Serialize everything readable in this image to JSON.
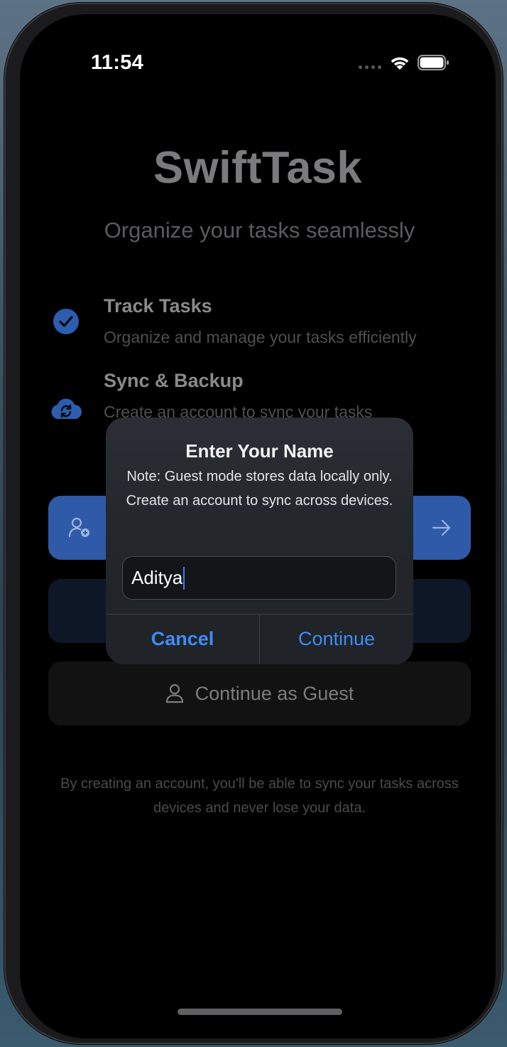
{
  "status_bar": {
    "time": "11:54"
  },
  "app": {
    "title": "SwiftTask",
    "subtitle": "Organize your tasks seamlessly"
  },
  "features": [
    {
      "title": "Track Tasks",
      "description": "Organize and manage your tasks efficiently",
      "icon": "checkmark-circle-icon"
    },
    {
      "title": "Sync & Backup",
      "description": "Create an account to sync your tasks",
      "icon": "cloud-sync-icon"
    }
  ],
  "buttons": {
    "guest_label": "Continue as Guest"
  },
  "footer": {
    "note": "By creating an account, you'll be able to sync your tasks across devices and never lose your data."
  },
  "alert": {
    "title": "Enter Your Name",
    "message": "Note: Guest mode stores data locally only. Create an account to sync across devices.",
    "input_value": "Aditya",
    "cancel_label": "Cancel",
    "continue_label": "Continue"
  },
  "colors": {
    "accent": "#3e8cf6",
    "primary_button": "#2f5aa8"
  }
}
